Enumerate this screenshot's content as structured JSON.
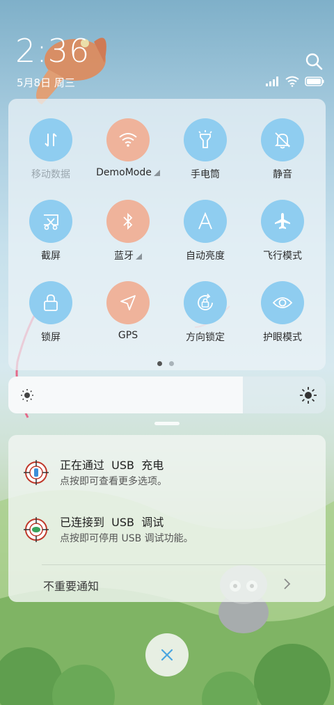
{
  "status_bar": {
    "time": "2:36",
    "date": "5月8日 周三"
  },
  "quick_settings": {
    "tiles": [
      {
        "id": "mobile-data",
        "label": "移动数据",
        "active": false,
        "dimmed": true,
        "icon": "mobile-data-icon"
      },
      {
        "id": "wifi",
        "label": "DemoMode",
        "active": true,
        "expandable": true,
        "icon": "wifi-icon"
      },
      {
        "id": "flashlight",
        "label": "手电筒",
        "active": false,
        "icon": "flashlight-icon"
      },
      {
        "id": "mute",
        "label": "静音",
        "active": false,
        "icon": "bell-off-icon"
      },
      {
        "id": "screenshot",
        "label": "截屏",
        "active": false,
        "icon": "screenshot-icon"
      },
      {
        "id": "bluetooth",
        "label": "蓝牙",
        "active": true,
        "expandable": true,
        "icon": "bluetooth-icon"
      },
      {
        "id": "auto-brightness",
        "label": "自动亮度",
        "active": false,
        "icon": "auto-brightness-icon"
      },
      {
        "id": "airplane",
        "label": "飞行模式",
        "active": false,
        "icon": "airplane-icon"
      },
      {
        "id": "lock",
        "label": "锁屏",
        "active": false,
        "icon": "lock-icon"
      },
      {
        "id": "gps",
        "label": "GPS",
        "active": true,
        "icon": "location-arrow-icon"
      },
      {
        "id": "rotation-lock",
        "label": "方向锁定",
        "active": false,
        "icon": "rotation-lock-icon"
      },
      {
        "id": "eye-care",
        "label": "护眼模式",
        "active": false,
        "icon": "eye-icon"
      }
    ],
    "page_indicator": {
      "pages": 2,
      "current": 1
    }
  },
  "brightness": {
    "level": 0.74
  },
  "notifications": [
    {
      "title": "正在通过  USB  充电",
      "text": "点按即可查看更多选项。",
      "icon": "usb-charging-icon"
    },
    {
      "title": "已连接到  USB  调试",
      "text": "点按即可停用 USB 调试功能。",
      "icon": "usb-debug-icon"
    }
  ],
  "minor_notifications_label": "不重要通知",
  "colors": {
    "tile_off": "#8fcdf0",
    "tile_on": "#efb39b"
  }
}
